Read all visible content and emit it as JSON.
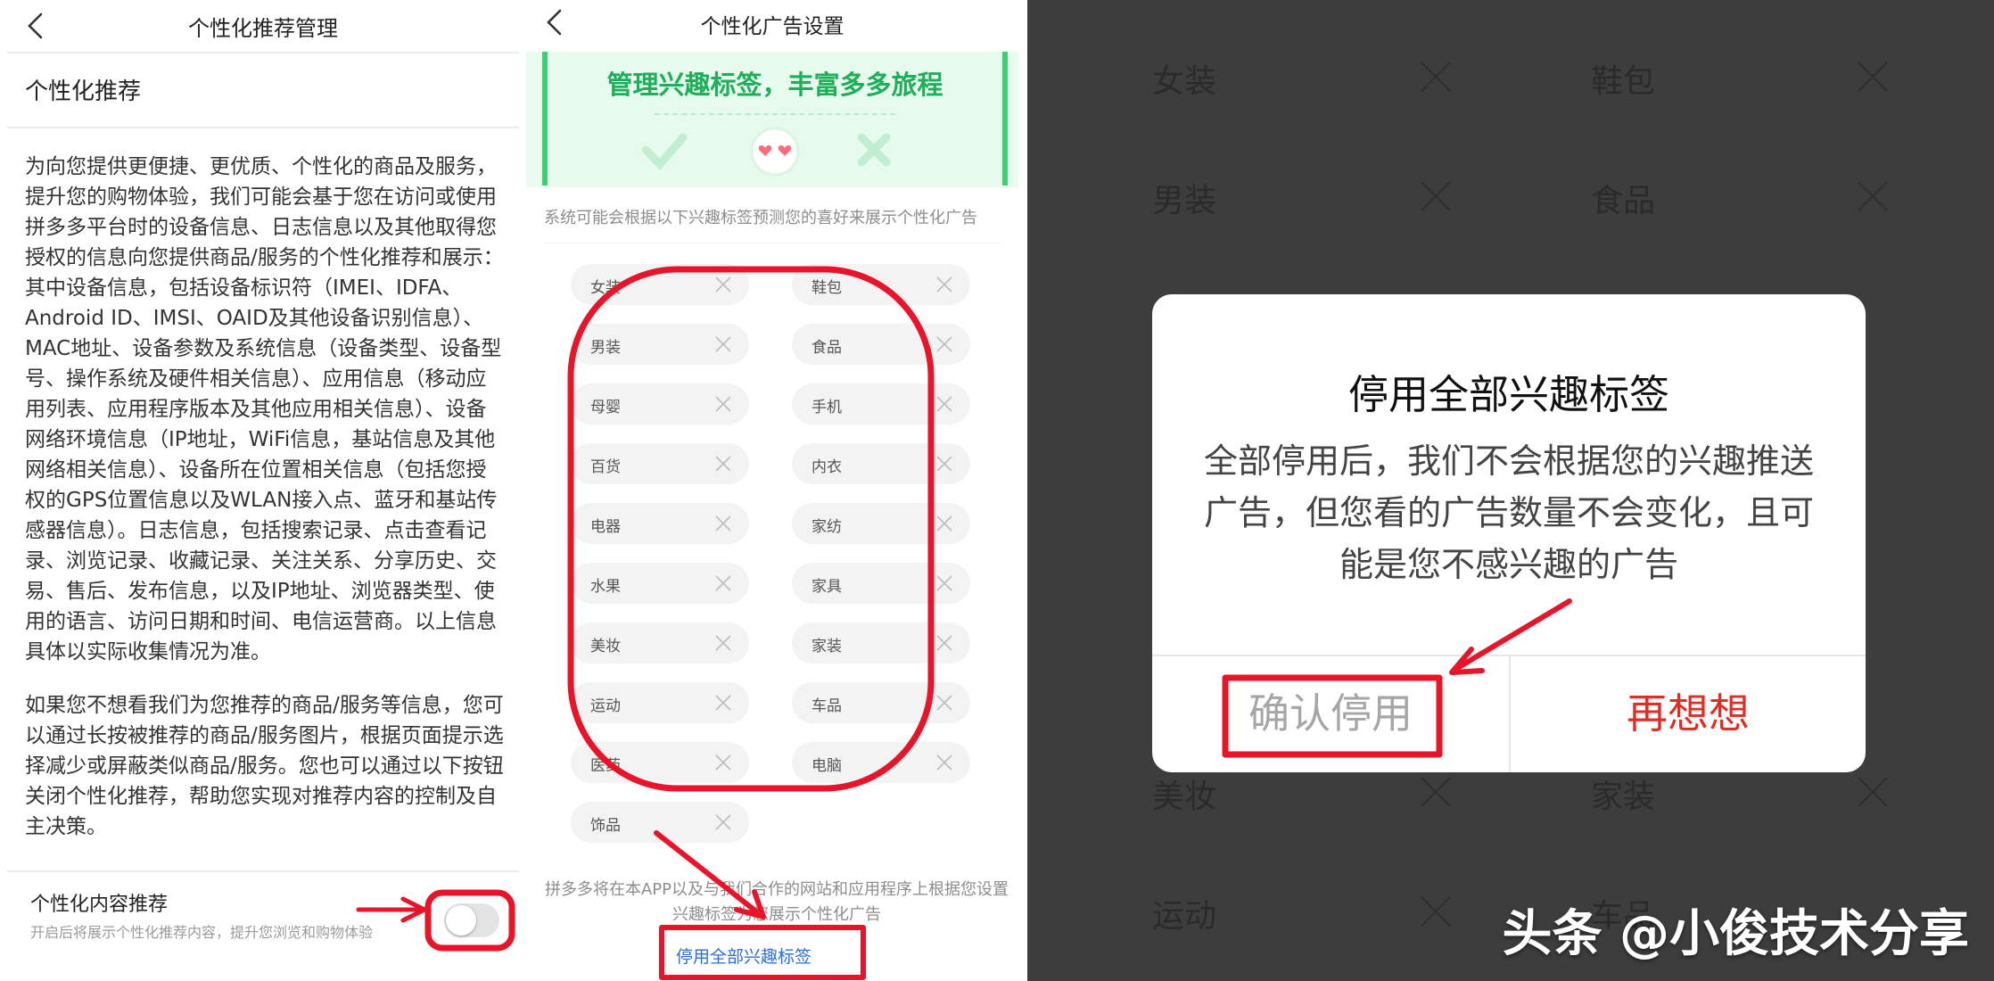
{
  "panel1": {
    "title": "个性化推荐管理",
    "section_title": "个性化推荐",
    "paragraph1": "为向您提供更便捷、更优质、个性化的商品及服务，提升您的购物体验，我们可能会基于您在访问或使用拼多多平台时的设备信息、日志信息以及其他取得您授权的信息向您提供商品/服务的个性化推荐和展示：其中设备信息，包括设备标识符（IMEI、IDFA、Android ID、IMSI、OAID及其他设备识别信息）、MAC地址、设备参数及系统信息（设备类型、设备型号、操作系统及硬件相关信息）、应用信息（移动应用列表、应用程序版本及其他应用相关信息）、设备网络环境信息（IP地址，WiFi信息，基站信息及其他网络相关信息）、设备所在位置相关信息（包括您授权的GPS位置信息以及WLAN接入点、蓝牙和基站传感器信息）。日志信息，包括搜索记录、点击查看记录、浏览记录、收藏记录、关注关系、分享历史、交易、售后、发布信息，以及IP地址、浏览器类型、使用的语言、访问日期和时间、电信运营商。以上信息具体以实际收集情况为准。",
    "paragraph2": "如果您不想看我们为您推荐的商品/服务等信息，您可以通过长按被推荐的商品/服务图片，根据页面提示选择减少或屏蔽类似商品/服务。您也可以通过以下按钮关闭个性化推荐，帮助您实现对推荐内容的控制及自主决策。",
    "setting_label": "个性化内容推荐",
    "setting_desc": "开启后将展示个性化推荐内容，提升您浏览和购物体验",
    "toggle_on": false
  },
  "panel2": {
    "title": "个性化广告设置",
    "banner_title": "管理兴趣标签，丰富多多旅程",
    "hint": "系统可能会根据以下兴趣标签预测您的喜好来展示个性化广告",
    "tags_left": [
      "女装",
      "男装",
      "母婴",
      "百货",
      "电器",
      "水果",
      "美妆",
      "运动",
      "医药",
      "饰品"
    ],
    "tags_right": [
      "鞋包",
      "食品",
      "手机",
      "内衣",
      "家纺",
      "家具",
      "家装",
      "车品",
      "电脑"
    ],
    "footnote": "拼多多将在本APP以及与我们合作的网站和应用程序上根据您设置兴趣标签为您展示个性化广告",
    "disable_all": "停用全部兴趣标签"
  },
  "panel3": {
    "background_tags": [
      {
        "left": "女装",
        "right": "鞋包"
      },
      {
        "left": "男装",
        "right": "食品"
      },
      {
        "left": "美妆",
        "right": "家装"
      },
      {
        "left": "运动",
        "right": "车品"
      }
    ],
    "dialog": {
      "title": "停用全部兴趣标签",
      "message": "全部停用后，我们不会根据您的兴趣推送广告，但您看的广告数量不会变化，且可能是您不感兴趣的广告",
      "confirm": "确认停用",
      "cancel": "再想想"
    },
    "watermark": "头条 @小俊技术分享"
  },
  "colors": {
    "brand_red": "#e02e24",
    "annotation_red": "#e8152a",
    "banner_green": "#1fae5a",
    "link_blue": "#2c6fd6"
  }
}
